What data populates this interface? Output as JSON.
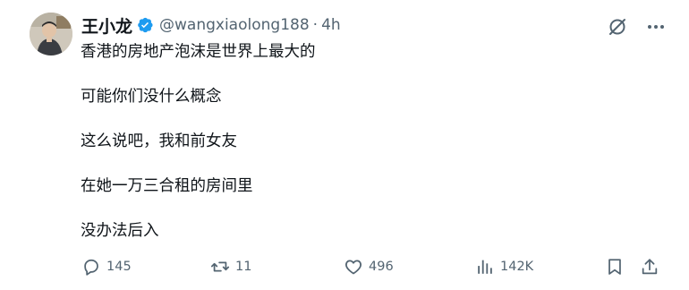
{
  "author": {
    "display_name": "王小龙",
    "handle": "@wangxiaolong188",
    "separator": "·",
    "time": "4h",
    "verified": true
  },
  "post": {
    "lines": [
      "香港的房地产泡沫是世界上最大的",
      "可能你们没什么概念",
      "这么说吧，我和前女友",
      "在她一万三合租的房间里",
      "没办法后入"
    ]
  },
  "actions": {
    "replies": "145",
    "reposts": "11",
    "likes": "496",
    "views": "142K"
  },
  "colors": {
    "text": "#0f1419",
    "muted": "#536471",
    "verified_badge": "#1d9bf0"
  },
  "icons": {
    "verified": "verified-badge-icon",
    "grok": "grok-icon",
    "more": "more-icon",
    "reply": "reply-icon",
    "repost": "repost-icon",
    "like": "heart-icon",
    "views": "views-icon",
    "bookmark": "bookmark-icon",
    "share": "share-icon"
  }
}
